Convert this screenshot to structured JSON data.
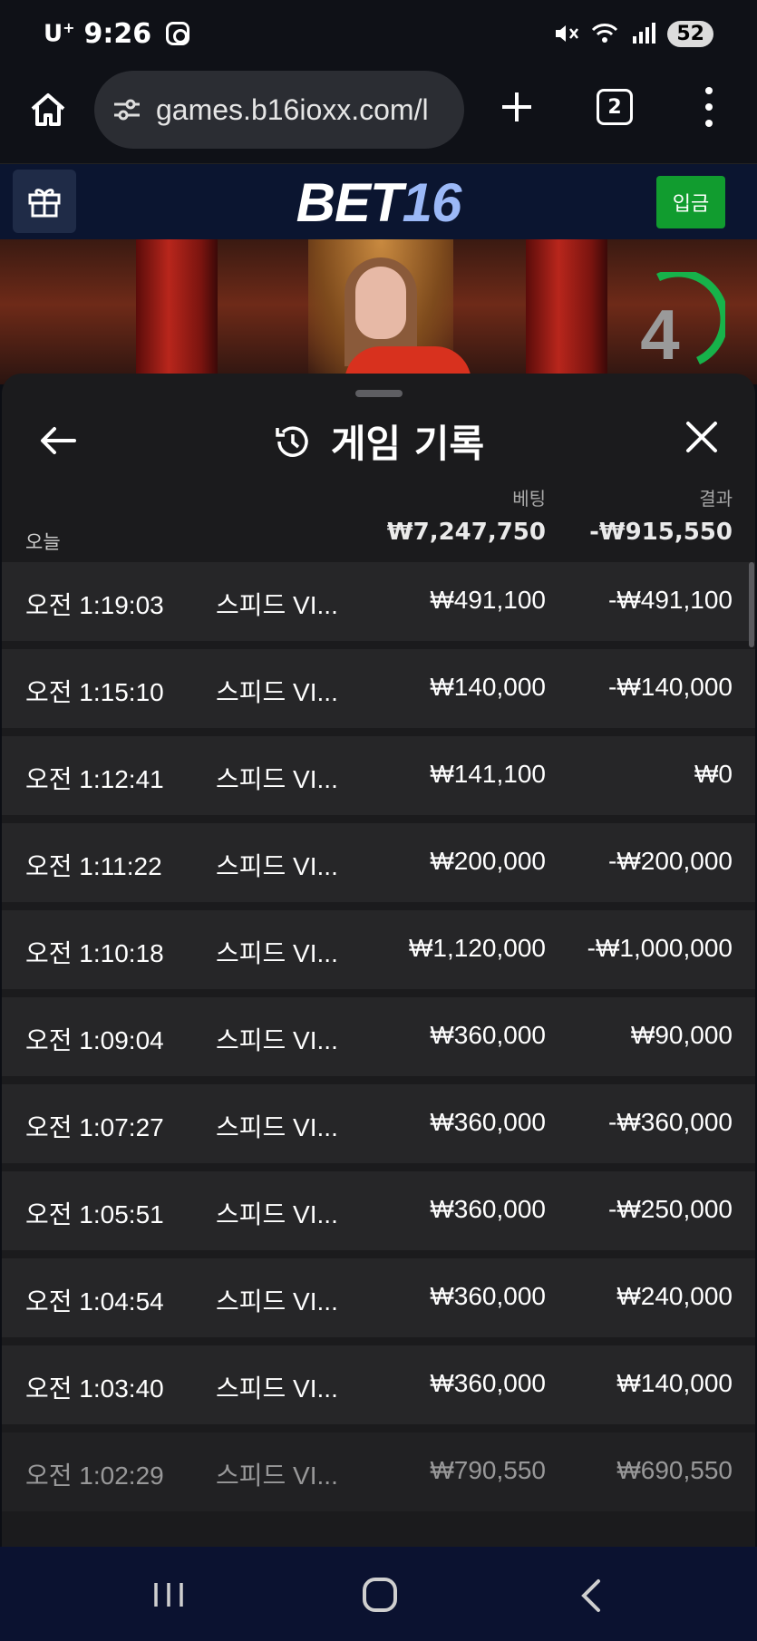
{
  "status_bar": {
    "carrier": "U",
    "carrier_sup": "+",
    "time": "9:26",
    "battery": "52",
    "icons": [
      "instagram-icon",
      "mute-icon",
      "wifi-icon",
      "signal-icon"
    ]
  },
  "browser": {
    "url": "games.b16ioxx.com/l",
    "tab_count": "2",
    "icons": [
      "home-icon",
      "site-settings-icon",
      "plus-icon",
      "more-icon"
    ]
  },
  "site": {
    "logo_part1": "BET",
    "logo_part2": "16",
    "deposit_label": "입금",
    "gift_icon": "gift-icon",
    "countdown": "4",
    "colors": {
      "header_bg": "#0b1530",
      "deposit": "#119c2f",
      "logo_accent": "#9bb8f7",
      "countdown_ring": "#17b24a"
    }
  },
  "history": {
    "title": "게임 기록",
    "bet_header": "베팅",
    "result_header": "결과",
    "today_label": "오늘",
    "total_bet": "₩7,247,750",
    "total_result": "-₩915,550",
    "rows": [
      {
        "time": "오전 1:19:03",
        "game": "스피드 VI...",
        "bet": "₩491,100",
        "result": "-₩491,100"
      },
      {
        "time": "오전 1:15:10",
        "game": "스피드 VI...",
        "bet": "₩140,000",
        "result": "-₩140,000"
      },
      {
        "time": "오전 1:12:41",
        "game": "스피드 VI...",
        "bet": "₩141,100",
        "result": "₩0"
      },
      {
        "time": "오전 1:11:22",
        "game": "스피드 VI...",
        "bet": "₩200,000",
        "result": "-₩200,000"
      },
      {
        "time": "오전 1:10:18",
        "game": "스피드 VI...",
        "bet": "₩1,120,000",
        "result": "-₩1,000,000"
      },
      {
        "time": "오전 1:09:04",
        "game": "스피드 VI...",
        "bet": "₩360,000",
        "result": "₩90,000"
      },
      {
        "time": "오전 1:07:27",
        "game": "스피드 VI...",
        "bet": "₩360,000",
        "result": "-₩360,000"
      },
      {
        "time": "오전 1:05:51",
        "game": "스피드 VI...",
        "bet": "₩360,000",
        "result": "-₩250,000"
      },
      {
        "time": "오전 1:04:54",
        "game": "스피드 VI...",
        "bet": "₩360,000",
        "result": "₩240,000"
      },
      {
        "time": "오전 1:03:40",
        "game": "스피드 VI...",
        "bet": "₩360,000",
        "result": "₩140,000"
      },
      {
        "time": "오전 1:02:29",
        "game": "스피드 VI...",
        "bet": "₩790,550",
        "result": "₩690,550"
      }
    ]
  },
  "nav": {
    "icons": [
      "recent-apps-icon",
      "home-circle-icon",
      "back-chevron-icon"
    ]
  }
}
